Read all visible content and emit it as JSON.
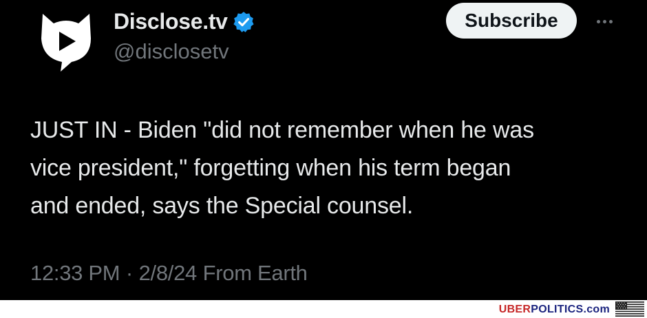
{
  "account": {
    "display_name": "Disclose.tv",
    "handle": "@disclosetv",
    "avatar_icon": "disclose-play-bubble-icon",
    "verified_icon": "verified-badge-icon",
    "verified_color": "#1d9bf0"
  },
  "header": {
    "subscribe_label": "Subscribe",
    "more_icon": "more-options-icon"
  },
  "tweet": {
    "lines": [
      "JUST IN - Biden \"did not remember when he was",
      "vice president,\" forgetting when his term began",
      "and ended, says the Special counsel."
    ],
    "time": "12:33 PM",
    "separator": "·",
    "date": "2/8/24",
    "source": "From Earth"
  },
  "watermark": {
    "part1": "UBER",
    "part2": "POLITICS.com",
    "flag_icon": "us-flag-icon"
  },
  "colors": {
    "background": "#000000",
    "primary_text": "#e7e9ea",
    "secondary_text": "#71767b",
    "button_bg": "#eff3f4",
    "watermark_red": "#c62828",
    "watermark_navy": "#1a237e"
  }
}
